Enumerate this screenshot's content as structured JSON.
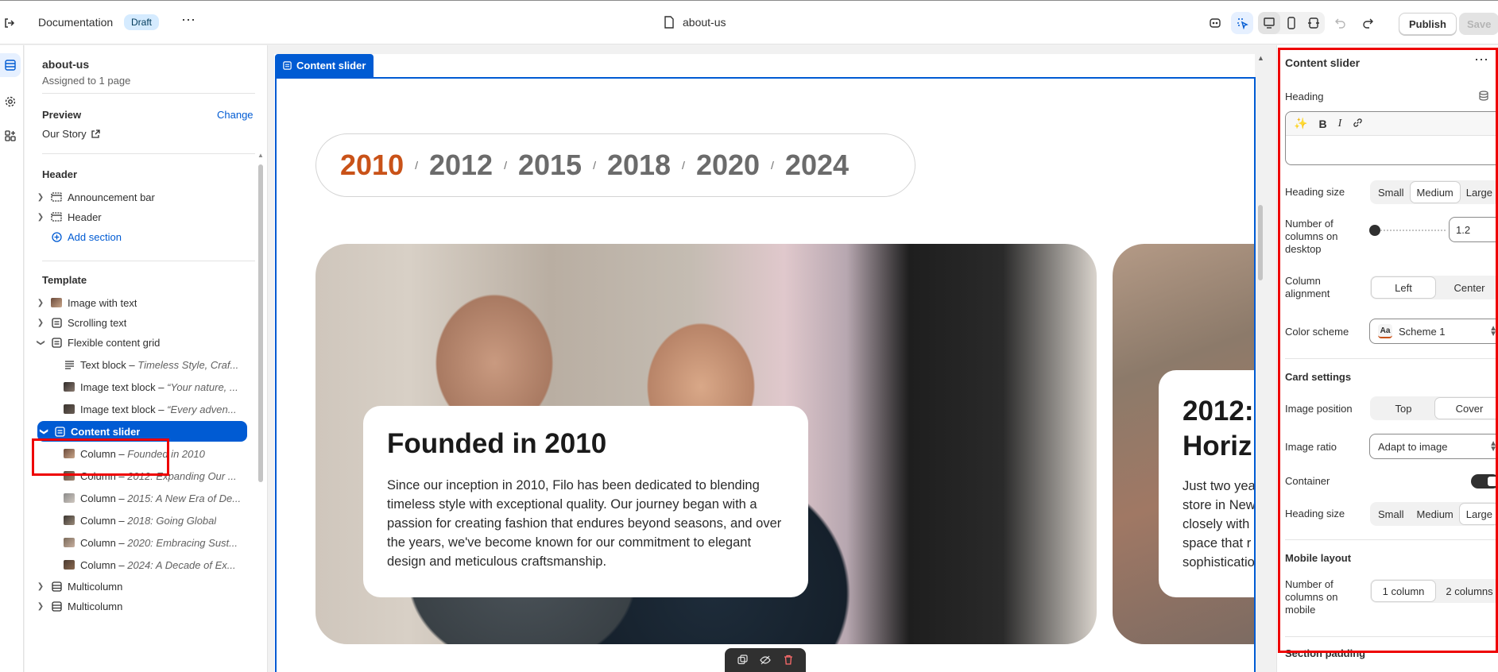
{
  "topbar": {
    "title": "Documentation",
    "badge": "Draft",
    "more": "⋯",
    "file_name": "about-us",
    "publish_label": "Publish",
    "save_label": "Save",
    "icons": [
      "exit-icon",
      "file-icon",
      "app-icon",
      "select-tool-icon",
      "desktop-icon",
      "mobile-icon",
      "fullwidth-icon",
      "undo-icon",
      "redo-icon"
    ]
  },
  "rail": {
    "icons": [
      "sections-icon",
      "settings-icon",
      "apps-icon"
    ]
  },
  "sidebar": {
    "page_name": "about-us",
    "assigned": "Assigned to 1 page",
    "preview_label": "Preview",
    "change_label": "Change",
    "preview_value": "Our Story",
    "header_group": "Header",
    "header_items": [
      {
        "label": "Announcement bar"
      },
      {
        "label": "Header"
      }
    ],
    "add_section": "Add section",
    "template_group": "Template",
    "template_items": [
      {
        "label": "Image with text"
      },
      {
        "label": "Scrolling text"
      },
      {
        "label": "Flexible content grid"
      }
    ],
    "grid_children": [
      {
        "prefix": "Text block – ",
        "sub": "Timeless Style, Craf..."
      },
      {
        "prefix": "Image text block – ",
        "sub": "“Your nature, ..."
      },
      {
        "prefix": "Image text block – ",
        "sub": "“Every adven..."
      }
    ],
    "selected": "Content slider",
    "slider_children": [
      {
        "prefix": "Column – ",
        "sub": "Founded in 2010"
      },
      {
        "prefix": "Column – ",
        "sub": "2012: Expanding Our ..."
      },
      {
        "prefix": "Column – ",
        "sub": "2015: A New Era of De..."
      },
      {
        "prefix": "Column – ",
        "sub": "2018: Going Global"
      },
      {
        "prefix": "Column – ",
        "sub": "2020: Embracing Sust..."
      },
      {
        "prefix": "Column – ",
        "sub": "2024: A Decade of Ex..."
      }
    ],
    "after_items": [
      {
        "label": "Multicolumn"
      },
      {
        "label": "Multicolumn"
      }
    ]
  },
  "canvas": {
    "section_tag": "Content slider",
    "years": [
      "2010",
      "2012",
      "2015",
      "2018",
      "2020",
      "2024"
    ],
    "slash": "/",
    "card1_title": "Founded in 2010",
    "card1_text": "Since our inception in 2010, Filo has been dedicated to blending timeless style with exceptional quality. Our journey began with a passion for creating fashion that endures beyond seasons, and over the years, we've become known for our commitment to elegant design and meticulous craftsmanship.",
    "card2_title_1": "2012:",
    "card2_title_2": "Horiz",
    "card2_lines": [
      "Just two yea",
      "store in New",
      "closely with",
      "space that r",
      "sophisticatio"
    ]
  },
  "panel": {
    "title": "Content slider",
    "heading_label": "Heading",
    "heading_size_label": "Heading size",
    "size_options": [
      "Small",
      "Medium",
      "Large"
    ],
    "columns_desktop_label": [
      "Number of",
      "columns on",
      "desktop"
    ],
    "columns_desktop_value": "1.2",
    "alignment_label": [
      "Column",
      "alignment"
    ],
    "alignment_options": [
      "Left",
      "Center"
    ],
    "color_scheme_label": "Color scheme",
    "color_scheme_value": "Scheme 1",
    "color_scheme_swatch": "Aa",
    "card_settings": "Card settings",
    "image_position_label": "Image position",
    "image_position_options": [
      "Top",
      "Cover"
    ],
    "image_ratio_label": "Image ratio",
    "image_ratio_value": "Adapt to image",
    "container_label": "Container",
    "card_heading_size_label": "Heading size",
    "mobile_layout": "Mobile layout",
    "columns_mobile_label": [
      "Number of",
      "columns on",
      "mobile"
    ],
    "columns_mobile_options": [
      "1 column",
      "2 columns"
    ],
    "section_padding": "Section padding"
  },
  "colors": {
    "accent": "#005bd3",
    "active_year": "#c95218",
    "highlight": "#ee0000"
  }
}
